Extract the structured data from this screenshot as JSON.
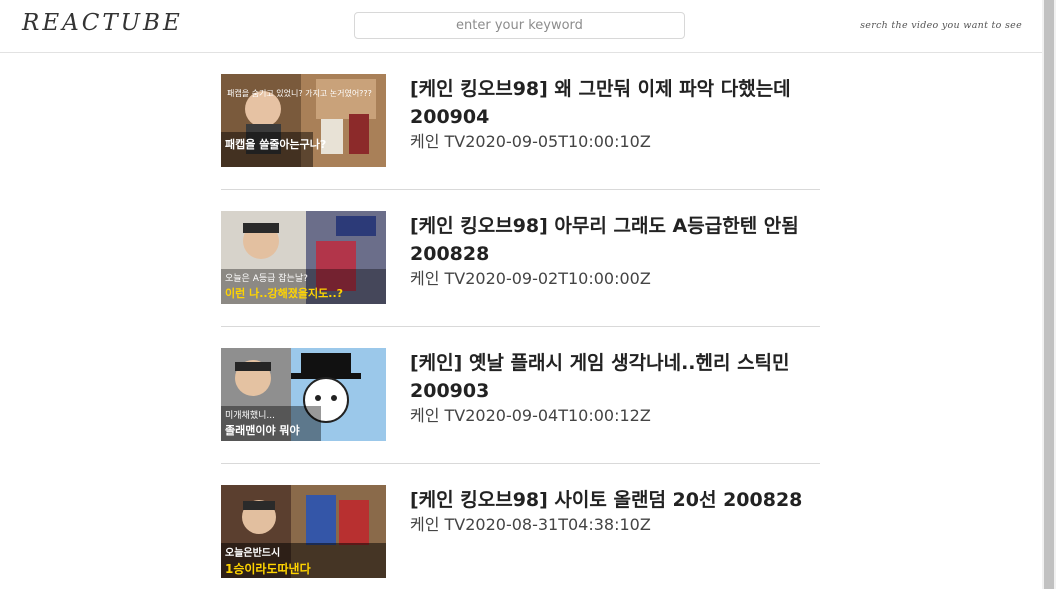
{
  "header": {
    "logo": "REACTUBE",
    "search_placeholder": "enter your keyword",
    "hint": "serch the video you want to see"
  },
  "videos": [
    {
      "title": "[케인 킹오브98] 왜 그만둬 이제 파악 다했는데 200904",
      "channel_date": "케인 TV2020-09-05T10:00:10Z",
      "thumb_text_top": "패캡을 숨기고 있었니? 가지고 논거였어???",
      "thumb_text_bottom": "패캡을 쓸줄아는구나?"
    },
    {
      "title": "[케인 킹오브98] 아무리 그래도 A등급한텐 안됨 200828",
      "channel_date": "케인 TV2020-09-02T10:00:00Z",
      "thumb_text_top": "오늘은 A등급 잡는날?",
      "thumb_text_bottom": "이런 나..강해졌을지도..?"
    },
    {
      "title": "[케인] 옛날 플래시 게임 생각나네..헨리 스틱민 200903",
      "channel_date": "케인 TV2020-09-04T10:00:12Z",
      "thumb_text_top": "미개채했니...",
      "thumb_text_bottom": "졸래맨이야 뭐야"
    },
    {
      "title": "[케인 킹오브98] 사이토 올랜덤 20선 200828",
      "channel_date": "케인 TV2020-08-31T04:38:10Z",
      "thumb_text_top": "오늘은반드시",
      "thumb_text_bottom": "1승이라도따낸다"
    }
  ]
}
